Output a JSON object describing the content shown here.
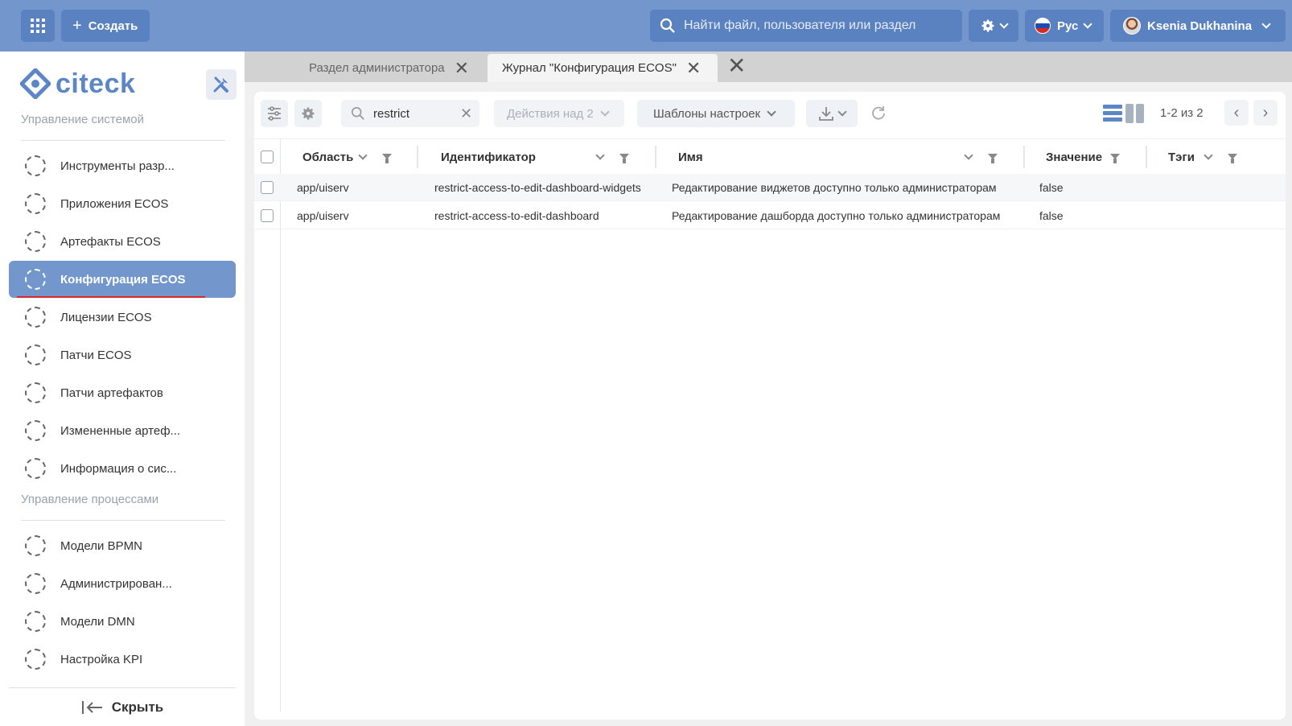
{
  "topbar": {
    "create_label": "Создать",
    "search_placeholder": "Найти файл, пользователя или раздел",
    "language": "Рус",
    "user_name": "Ksenia Dukhanina"
  },
  "sidebar": {
    "logo_text": "citeck",
    "section_system": "Управление системой",
    "system_items": [
      {
        "label": "Инструменты разр..."
      },
      {
        "label": "Приложения ECOS"
      },
      {
        "label": "Артефакты ECOS"
      },
      {
        "label": "Конфигурация ECOS"
      },
      {
        "label": "Лицензии ECOS"
      },
      {
        "label": "Патчи ECOS"
      },
      {
        "label": "Патчи артефактов"
      },
      {
        "label": "Измененные артеф..."
      },
      {
        "label": "Информация о сис..."
      }
    ],
    "section_process": "Управление процессами",
    "process_items": [
      {
        "label": "Модели BPMN"
      },
      {
        "label": "Администрирован..."
      },
      {
        "label": "Модели DMN"
      },
      {
        "label": "Настройка KPI"
      }
    ],
    "hide_label": "Скрыть"
  },
  "tabs": [
    {
      "label": "Раздел администратора"
    },
    {
      "label": "Журнал \"Конфигурация ECOS\""
    }
  ],
  "toolbar": {
    "search_value": "restrict",
    "actions_label": "Действия над 2",
    "templates_label": "Шаблоны настроек",
    "counter": "1-2 из 2"
  },
  "table": {
    "columns": [
      "Область",
      "Идентификатор",
      "Имя",
      "Значение",
      "Тэги"
    ],
    "rows": [
      {
        "area": "app/uiserv",
        "id": "restrict-access-to-edit-dashboard-widgets",
        "name": "Редактирование виджетов доступно только администраторам",
        "value": "false",
        "tags": ""
      },
      {
        "area": "app/uiserv",
        "id": "restrict-access-to-edit-dashboard",
        "name": "Редактирование дашборда доступно только администраторам",
        "value": "false",
        "tags": ""
      }
    ]
  },
  "colors": {
    "primary": "#7396cd",
    "primary_dark": "#5a81c0",
    "active_underline": "#d8262b"
  }
}
